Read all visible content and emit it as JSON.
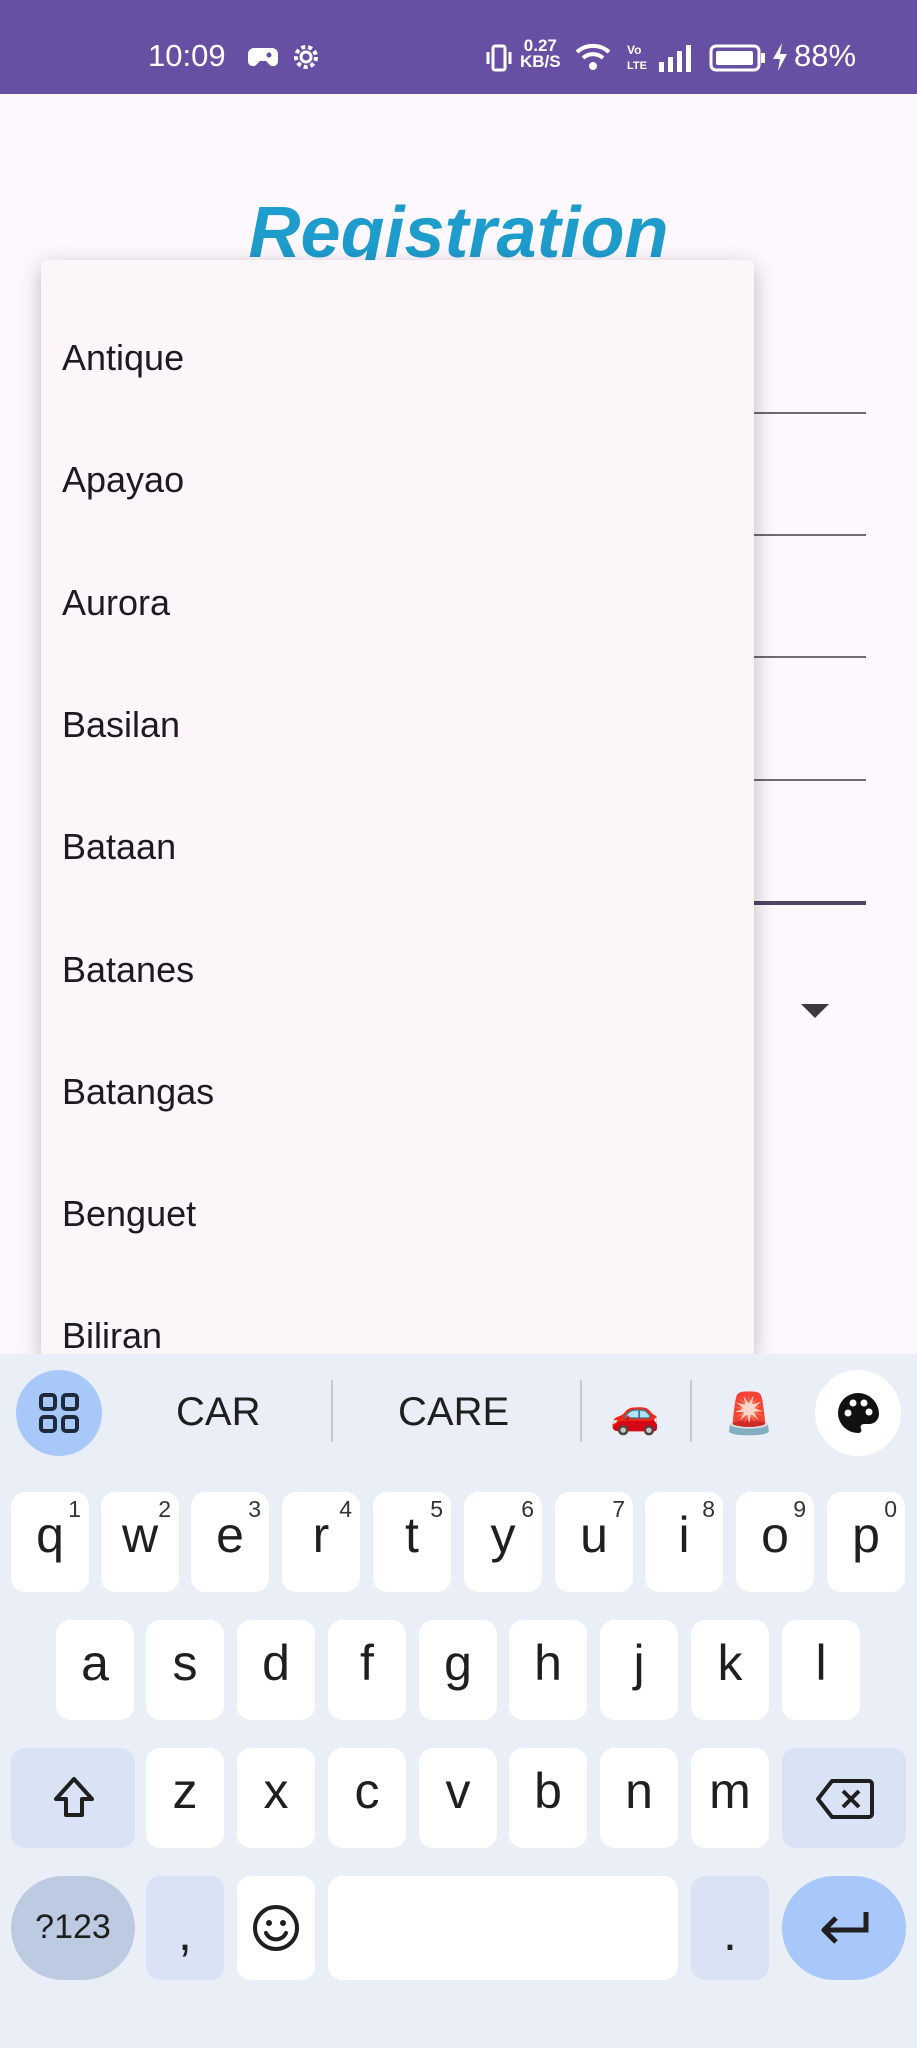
{
  "status_bar": {
    "time": "10:09",
    "net_speed_value": "0.27",
    "net_speed_unit": "KB/S",
    "volte": "Vo LTE",
    "battery": "88%"
  },
  "page": {
    "title": "Registration"
  },
  "dropdown": {
    "items": [
      "Antique",
      "Apayao",
      "Aurora",
      "Basilan",
      "Bataan",
      "Batanes",
      "Batangas",
      "Benguet",
      "Biliran"
    ]
  },
  "keyboard": {
    "suggestions": [
      "CAR",
      "CARE"
    ],
    "emoji_suggestions": [
      "🚗",
      "🚨"
    ],
    "row1": [
      {
        "k": "q",
        "h": "1"
      },
      {
        "k": "w",
        "h": "2"
      },
      {
        "k": "e",
        "h": "3"
      },
      {
        "k": "r",
        "h": "4"
      },
      {
        "k": "t",
        "h": "5"
      },
      {
        "k": "y",
        "h": "6"
      },
      {
        "k": "u",
        "h": "7"
      },
      {
        "k": "i",
        "h": "8"
      },
      {
        "k": "o",
        "h": "9"
      },
      {
        "k": "p",
        "h": "0"
      }
    ],
    "row2": [
      "a",
      "s",
      "d",
      "f",
      "g",
      "h",
      "j",
      "k",
      "l"
    ],
    "row3": [
      "z",
      "x",
      "c",
      "v",
      "b",
      "n",
      "m"
    ],
    "symbols_label": "?123",
    "comma": ",",
    "period": "."
  }
}
